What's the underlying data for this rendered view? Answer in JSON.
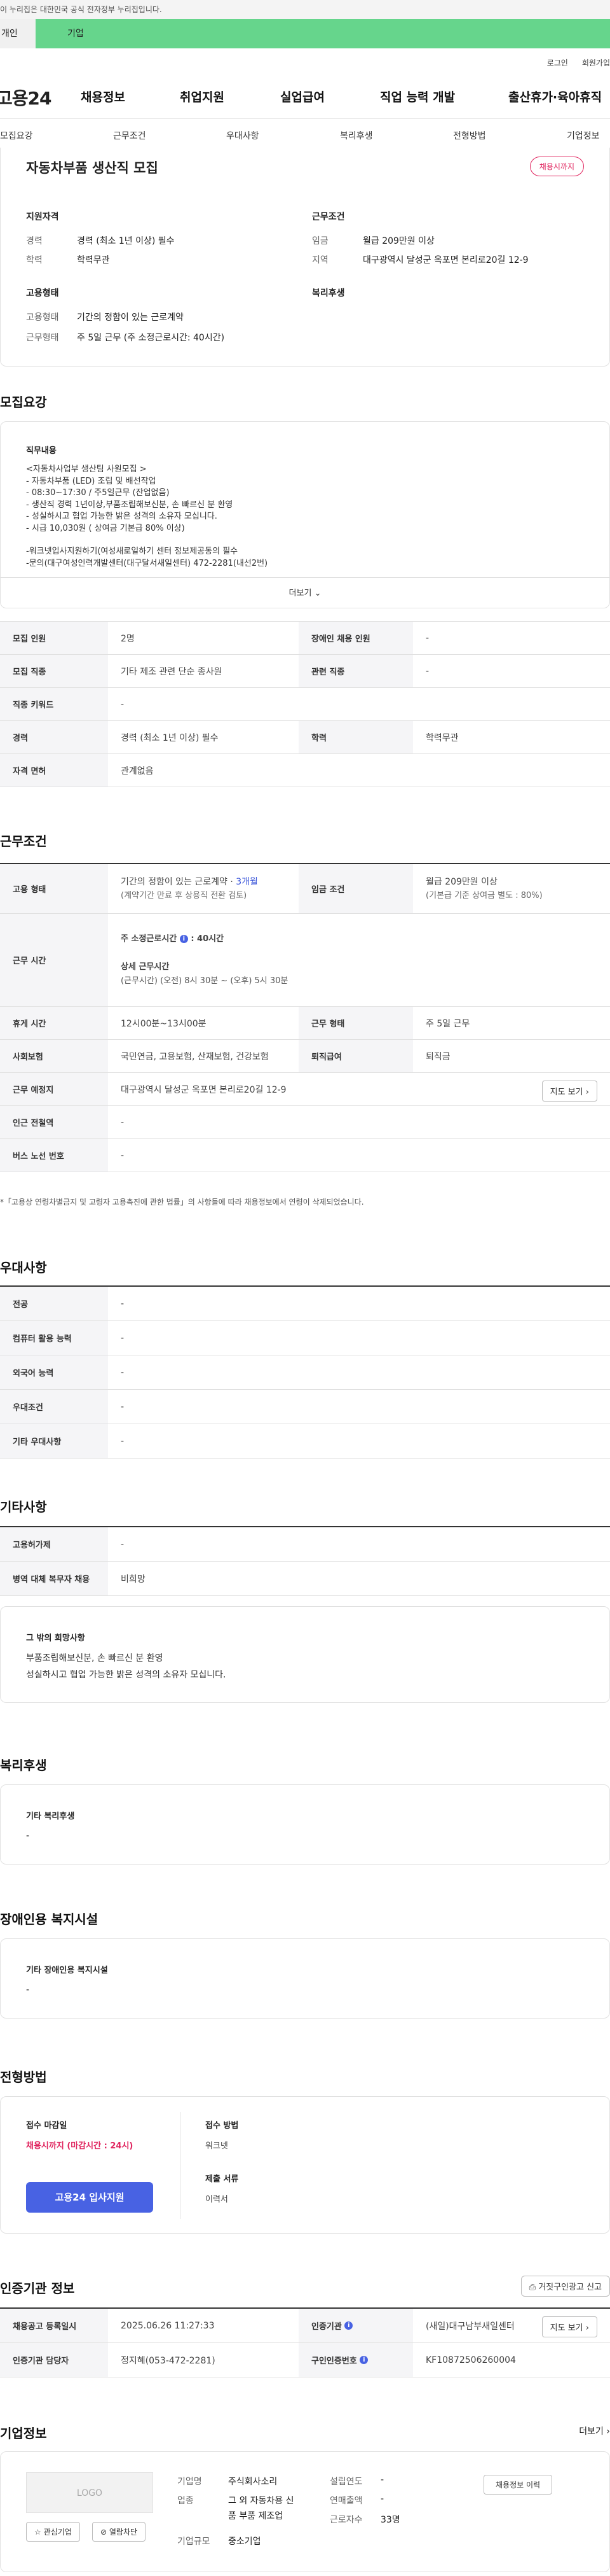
{
  "gov_banner": "이 누리집은 대한민국 공식 전자정부 누리집입니다.",
  "user_tabs": [
    "개인",
    "기업"
  ],
  "util_links": [
    "로그인",
    "회원가입"
  ],
  "logo": "고용24",
  "gnb": [
    "채용정보",
    "취업지원",
    "실업급여",
    "직업 능력 개발",
    "출산휴가·육아휴직"
  ],
  "subtabs": [
    "모집요강",
    "근무조건",
    "우대사항",
    "복리후생",
    "전형방법",
    "기업정보"
  ],
  "summary": {
    "title": "자동차부품 생산직 모집",
    "badge": "채용시까지",
    "qual_title": "지원자격",
    "cond_title": "근무조건",
    "form_title": "고용형태",
    "welfare_title": "복리후생",
    "career_label": "경력",
    "career_value": "경력 (최소 1년 이상) 필수",
    "edu_label": "학력",
    "edu_value": "학력무관",
    "wage_label": "임금",
    "wage_value": "월급 209만원 이상",
    "region_label": "지역",
    "region_value": "대구광역시 달성군 옥포면 본리로20길 12-9",
    "emptype_label": "고용형태",
    "emptype_value": "기간의 정함이 있는 근로계약",
    "worktype_label": "근무형태",
    "worktype_value": "주 5일 근무 (주 소정근로시간: 40시간)"
  },
  "recruit": {
    "section": "모집요강",
    "duty_title": "직무내용",
    "duty_lines": [
      "<자동차사업부 생산팀 사원모집 >",
      "- 자동차부품 (LED) 조립 및 배선작업",
      "- 08:30~17:30 / 주5일근무 (잔업없음)",
      "- 생산직 경력 1년이상,부품조립해보신분, 손 빠르신 분 환영",
      "- 성실하시고 협업 가능한 밝은 성격의 소유자 모십니다.",
      "- 시급 10,030원 ( 상여금 기본급 80% 이상)",
      "",
      "-워크넷입사지원하기(여성새로일하기 센터 정보제공동의 필수",
      "-문의(대구여성인력개발센터(대구달서새일센터) 472-2281(내선2번)"
    ],
    "more": "더보기",
    "rows": [
      {
        "a": "모집 인원",
        "b": "2명",
        "c": "장애인 채용 인원",
        "d": "-"
      },
      {
        "a": "모집 직종",
        "b": "기타 제조 관련 단순 종사원",
        "c": "관련 직종",
        "d": "-"
      },
      {
        "a": "직종 키워드",
        "b": "-"
      },
      {
        "a": "경력",
        "b": "경력 (최소 1년 이상) 필수",
        "c": "학력",
        "d": "학력무관"
      },
      {
        "a": "자격 면허",
        "b": "관계없음"
      }
    ]
  },
  "work": {
    "section": "근무조건",
    "emp_label": "고용 형태",
    "emp_v1": "기간의 정함이 있는 근로계약 · ",
    "emp_v1b": "3개월",
    "emp_v2": "(계약기간 만료 후 상용직 전환 검토)",
    "wage_label": "임금 조건",
    "wage_v1": "월급 209만원 이상",
    "wage_v2": "(기본급 기준 상여금 별도 : 80%)",
    "time_label": "근무 시간",
    "time_sub1": "주 소정근로시간",
    "time_sub1v": ": 40시간",
    "time_sub2": "상세 근무시간",
    "time_sub2v": "(근무시간) (오전) 8시 30분 ~ (오후) 5시 30분",
    "rest_label": "휴게 시간",
    "rest_v": "12시00분~13시00분",
    "form_label": "근무 형태",
    "form_v": "주 5일 근무",
    "ins_label": "사회보험",
    "ins_v": "국민연금, 고용보험, 산재보험, 건강보험",
    "ret_label": "퇴직급여",
    "ret_v": "퇴직금",
    "place_label": "근무 예정지",
    "place_v": "대구광역시 달성군 옥포면 본리로20길 12-9",
    "map_btn": "지도 보기",
    "station_label": "인근 전철역",
    "station_v": "-",
    "bus_label": "버스 노선 번호",
    "bus_v": "-",
    "note": "*「고용상 연령차별금지 및 고령자 고용촉진에 관한 법률」의 사항들에 따라 채용정보에서 연령이 삭제되었습니다."
  },
  "pref": {
    "section": "우대사항",
    "rows": [
      [
        "전공",
        "-"
      ],
      [
        "컴퓨터 활용 능력",
        "-"
      ],
      [
        "외국어 능력",
        "-"
      ],
      [
        "우대조건",
        "-"
      ],
      [
        "기타 우대사항",
        "-"
      ]
    ]
  },
  "etc": {
    "section": "기타사항",
    "rows": [
      [
        "고용허가제",
        "-"
      ],
      [
        "병역 대체 복무자 채용",
        "비희망"
      ]
    ],
    "hope_title": "그 밖의 희망사항",
    "hope_lines": [
      "부품조립해보신분, 손 빠르신 분 환영",
      "성실하시고 협업 가능한 밝은 성격의 소유자 모십니다."
    ]
  },
  "welfare": {
    "section": "복리후생",
    "box_title": "기타 복리후생",
    "box_v": "-"
  },
  "disab": {
    "section": "장애인용 복지시설",
    "box_title": "기타 장애인용 복지시설",
    "box_v": "-"
  },
  "select": {
    "section": "전형방법",
    "deadline_title": "접수 마감일",
    "deadline_v": "채용시까지 (마감시간 : 24시)",
    "apply_btn": "고용24 입사지원",
    "method_title": "접수 방법",
    "method_v": "워크넷",
    "docs_title": "제출 서류",
    "docs_v": "이력서"
  },
  "cert": {
    "section": "인증기관 정보",
    "report_btn": "거짓구인광고 신고",
    "reg_label": "채용공고 등록일시",
    "reg_v": "2025.06.26 11:27:33",
    "org_label": "인증기관",
    "org_v": "(새일)대구남부새일센터",
    "map_btn": "지도 보기",
    "mgr_label": "인증기관 담당자",
    "mgr_v": "정지혜(053-472-2281)",
    "num_label": "구인인증번호",
    "num_v": "KF10872506260004"
  },
  "company": {
    "section": "기업정보",
    "more": "더보기",
    "logo_text": "LOGO",
    "fav_btn": "관심기업",
    "block_btn": "열람차단",
    "name_label": "기업명",
    "name_v": "주식회사소리",
    "industry_label": "업종",
    "industry_v1": "그 외 자동차용 신",
    "industry_v2": "품 부품 제조업",
    "size_label": "기업규모",
    "size_v": "중소기업",
    "year_label": "설립연도",
    "year_v": "-",
    "sales_label": "연매출액",
    "sales_v": "-",
    "emp_label": "근로자수",
    "emp_v": "33명",
    "jobs_btn": "채용정보 이력"
  }
}
